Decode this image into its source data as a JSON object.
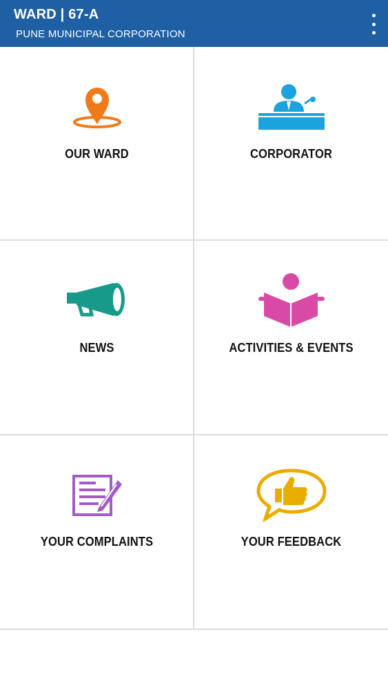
{
  "header": {
    "title": "WARD | 67-A",
    "subtitle": "PUNE MUNICIPAL CORPORATION",
    "menu_icon": "more-vert-icon",
    "color": "#1f5fa3"
  },
  "tiles": [
    {
      "label": "OUR WARD",
      "icon": "map-pin-icon",
      "color": "#f07a1a"
    },
    {
      "label": "CORPORATOR",
      "icon": "speaker-podium-icon",
      "color": "#1ba3de"
    },
    {
      "label": "NEWS",
      "icon": "megaphone-icon",
      "color": "#179a8a"
    },
    {
      "label": "ACTIVITIES & EVENTS",
      "icon": "reading-person-icon",
      "color": "#d94aa6"
    },
    {
      "label": "YOUR COMPLAINTS",
      "icon": "form-pen-icon",
      "color": "#a35bc7"
    },
    {
      "label": "YOUR FEEDBACK",
      "icon": "thumbs-up-bubble-icon",
      "color": "#e9ad00"
    }
  ]
}
